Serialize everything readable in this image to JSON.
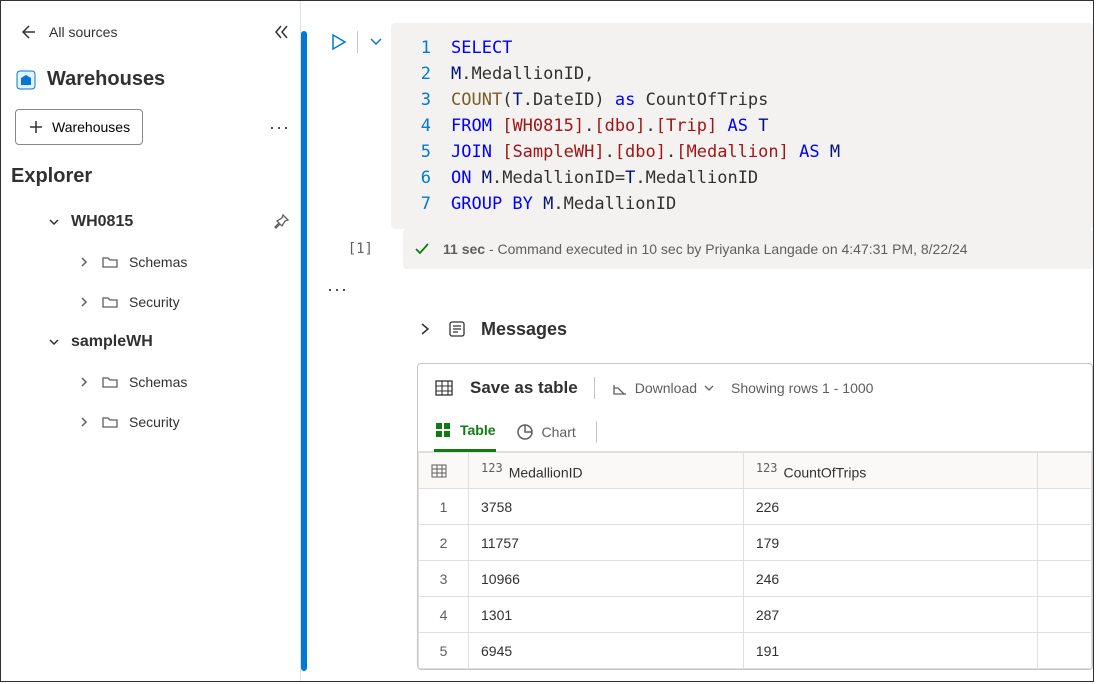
{
  "top": {
    "all_sources": "All sources"
  },
  "head": {
    "title": "Warehouses",
    "add_button": "Warehouses"
  },
  "explorer": {
    "title": "Explorer",
    "warehouses": [
      {
        "name": "WH0815",
        "children": [
          "Schemas",
          "Security"
        ]
      },
      {
        "name": "sampleWH",
        "children": [
          "Schemas",
          "Security"
        ]
      }
    ]
  },
  "code": {
    "lines": [
      [
        {
          "c": "kw",
          "t": "SELECT"
        }
      ],
      [
        {
          "c": "id",
          "t": "M"
        },
        {
          "c": "op",
          "t": "."
        },
        {
          "c": "plain",
          "t": "MedallionID"
        },
        {
          "c": "op",
          "t": ","
        }
      ],
      [
        {
          "c": "fn",
          "t": "COUNT"
        },
        {
          "c": "op",
          "t": "("
        },
        {
          "c": "id",
          "t": "T"
        },
        {
          "c": "op",
          "t": "."
        },
        {
          "c": "plain",
          "t": "DateID"
        },
        {
          "c": "op",
          "t": ") "
        },
        {
          "c": "kw",
          "t": "as"
        },
        {
          "c": "plain",
          "t": " CountOfTrips"
        }
      ],
      [
        {
          "c": "kw",
          "t": "FROM"
        },
        {
          "c": "plain",
          "t": " "
        },
        {
          "c": "str",
          "t": "[WH0815]"
        },
        {
          "c": "op",
          "t": "."
        },
        {
          "c": "str",
          "t": "[dbo]"
        },
        {
          "c": "op",
          "t": "."
        },
        {
          "c": "str",
          "t": "[Trip]"
        },
        {
          "c": "plain",
          "t": " "
        },
        {
          "c": "kw",
          "t": "AS"
        },
        {
          "c": "plain",
          "t": " "
        },
        {
          "c": "id",
          "t": "T"
        }
      ],
      [
        {
          "c": "kw",
          "t": "JOIN"
        },
        {
          "c": "plain",
          "t": " "
        },
        {
          "c": "str",
          "t": "[SampleWH]"
        },
        {
          "c": "op",
          "t": "."
        },
        {
          "c": "str",
          "t": "[dbo]"
        },
        {
          "c": "op",
          "t": "."
        },
        {
          "c": "str",
          "t": "[Medallion]"
        },
        {
          "c": "plain",
          "t": " "
        },
        {
          "c": "kw",
          "t": "AS"
        },
        {
          "c": "plain",
          "t": " "
        },
        {
          "c": "id",
          "t": "M"
        }
      ],
      [
        {
          "c": "kw",
          "t": "ON"
        },
        {
          "c": "plain",
          "t": " "
        },
        {
          "c": "id",
          "t": "M"
        },
        {
          "c": "op",
          "t": "."
        },
        {
          "c": "plain",
          "t": "MedallionID"
        },
        {
          "c": "op",
          "t": "="
        },
        {
          "c": "id",
          "t": "T"
        },
        {
          "c": "op",
          "t": "."
        },
        {
          "c": "plain",
          "t": "MedallionID"
        }
      ],
      [
        {
          "c": "kw",
          "t": "GROUP BY"
        },
        {
          "c": "plain",
          "t": " "
        },
        {
          "c": "id",
          "t": "M"
        },
        {
          "c": "op",
          "t": "."
        },
        {
          "c": "plain",
          "t": "MedallionID"
        }
      ]
    ]
  },
  "status": {
    "cell_index": "[1]",
    "duration_prefix": "11 sec",
    "text": " - Command executed in 10 sec by Priyanka Langade on 4:47:31 PM, 8/22/24"
  },
  "messages": {
    "title": "Messages"
  },
  "results": {
    "save": "Save as table",
    "download": "Download",
    "showing": "Showing rows 1 - 1000",
    "tab_table": "Table",
    "tab_chart": "Chart",
    "col_prefix": "123",
    "columns": [
      "MedallionID",
      "CountOfTrips"
    ],
    "rows": [
      [
        "3758",
        "226"
      ],
      [
        "11757",
        "179"
      ],
      [
        "10966",
        "246"
      ],
      [
        "1301",
        "287"
      ],
      [
        "6945",
        "191"
      ]
    ]
  }
}
